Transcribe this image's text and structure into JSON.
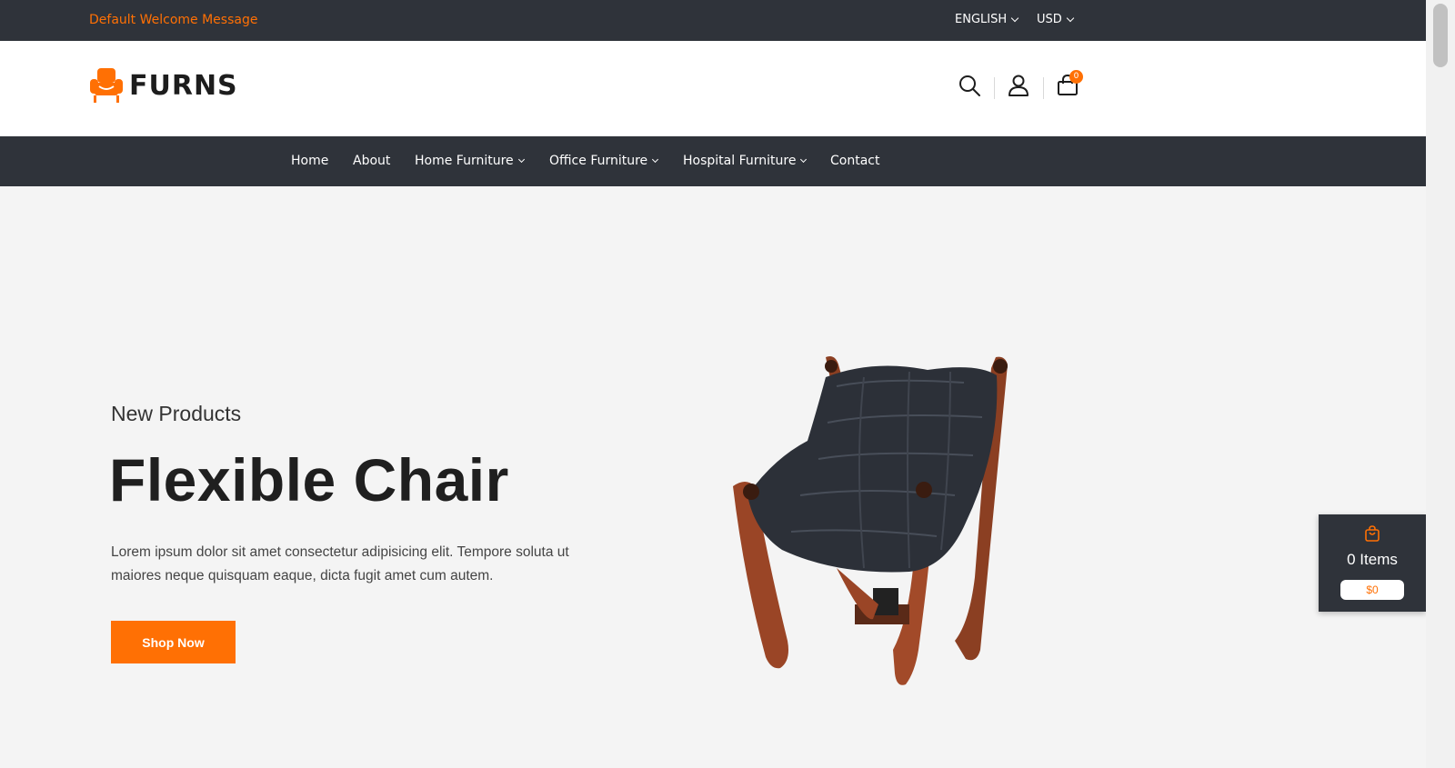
{
  "topbar": {
    "welcome": "Default Welcome Message",
    "language": "ENGLISH",
    "currency": "USD"
  },
  "header": {
    "logo_text": "FURNS",
    "cart_count": "0",
    "icons": [
      "search-icon",
      "user-icon",
      "shopping-bag-icon"
    ]
  },
  "nav": {
    "items": [
      {
        "label": "Home",
        "dropdown": false
      },
      {
        "label": "About",
        "dropdown": false
      },
      {
        "label": "Home Furniture",
        "dropdown": true
      },
      {
        "label": "Office Furniture",
        "dropdown": true
      },
      {
        "label": "Hospital Furniture",
        "dropdown": true
      },
      {
        "label": "Contact",
        "dropdown": false
      }
    ]
  },
  "hero": {
    "subtitle": "New Products",
    "title": "Flexible Chair",
    "description": "Lorem ipsum dolor sit amet consectetur adipisicing elit. Tempore soluta ut maiores neque quisquam eaque, dicta fugit amet cum autem.",
    "button": "Shop Now"
  },
  "float_cart": {
    "items": "0 Items",
    "price": "$0"
  },
  "colors": {
    "accent": "#ff7004",
    "dark": "#2f333a",
    "hero_bg": "#f4f4f4"
  }
}
